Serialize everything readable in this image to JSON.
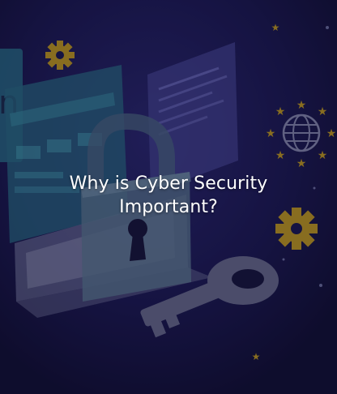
{
  "hero": {
    "title_line1": "Why is Cyber Security",
    "title_line2": "Important?"
  },
  "colors": {
    "background": "#13123a",
    "gold": "#c9a21c",
    "panel_teal": "#2a6f86",
    "panel_violet": "#4a4a9a",
    "lock_steel": "#5f7f95",
    "key_gray": "#6c6f8e"
  },
  "icons": [
    "gear-icon",
    "globe-icon",
    "star-icon",
    "padlock-icon",
    "key-icon",
    "laptop-icon"
  ]
}
